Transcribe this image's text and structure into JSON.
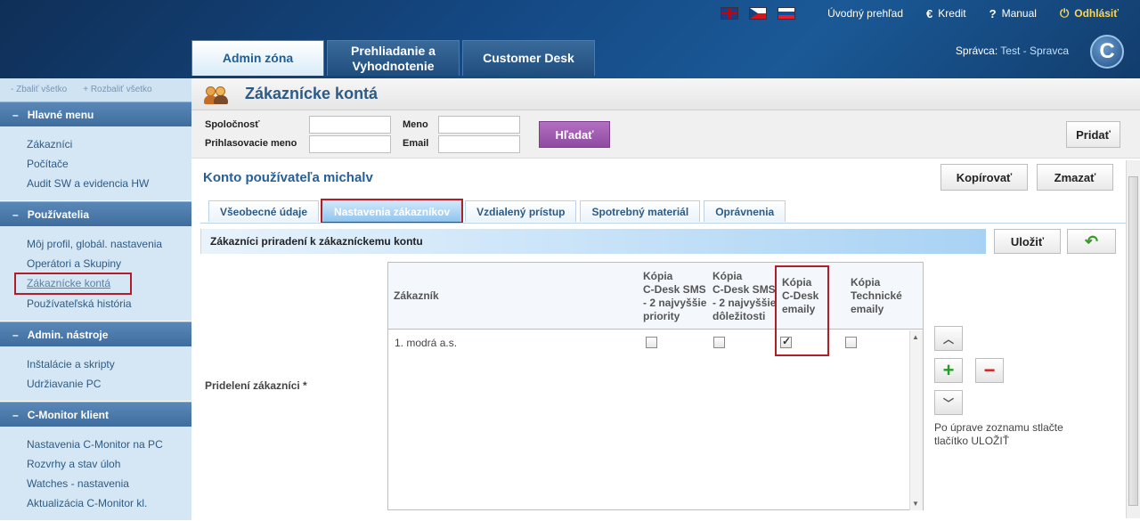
{
  "top": {
    "links": [
      {
        "icon": "home-icon",
        "label": "Úvodný prehľad"
      },
      {
        "icon": "euro-icon",
        "label": "Kredit",
        "glyph": "€"
      },
      {
        "icon": "help-icon",
        "label": "Manual",
        "glyph": "?"
      },
      {
        "icon": "power-icon",
        "label": "Odhlásiť",
        "glyph": "⏻"
      }
    ],
    "admin_label": "Správca:",
    "admin_name": "Test - Spravca",
    "logo_letter": "C"
  },
  "main_tabs": [
    {
      "label": "Admin zóna",
      "active": true
    },
    {
      "label": "Prehliadanie a Vyhodnotenie",
      "active": false
    },
    {
      "label": "Customer Desk",
      "active": false
    }
  ],
  "sidebar": {
    "collapse_all": "- Zbaliť všetko",
    "expand_all": "+ Rozbaliť všetko",
    "sections": [
      {
        "title": "Hlavné menu",
        "items": [
          "Zákazníci",
          "Počítače",
          "Audit SW a evidencia HW"
        ]
      },
      {
        "title": "Používatelia",
        "items": [
          "Môj profil, glob‌ál. nastavenia",
          "Operátori a Skupiny",
          "Zákaznícke kontá",
          "Používateľská história"
        ]
      },
      {
        "title": "Admin. nástroje",
        "items": [
          "Inštalácie a skripty",
          "Udržiavanie PC"
        ]
      },
      {
        "title": "C-Monitor klient",
        "items": [
          "Nastavenia C-Monitor na PC",
          "Rozvrhy a stav úloh",
          "Watches - nastavenia",
          "Aktualizácia C-Monitor kl."
        ]
      }
    ]
  },
  "page": {
    "title": "Zákaznícke kontá",
    "search": {
      "company_label": "Spoločnosť",
      "login_label": "Prihlasovacie meno",
      "name_label": "Meno",
      "email_label": "Email",
      "search_button": "Hľadať",
      "add_button": "Pridať"
    },
    "account_title": "Konto používateľa michalv",
    "copy_button": "Kopírovať",
    "delete_button": "Zmazať",
    "tabs": [
      "Všeobecné údaje",
      "Nastavenia zákazníkov",
      "Vzdialený prístup",
      "Spotrebný materiál",
      "Oprávnenia"
    ],
    "active_tab": 1,
    "bar_title": "Zákazníci priradení k zákazníckemu kontu",
    "save_button": "Uložiť",
    "assigned_label": "Pridelení zákazníci *",
    "grid": {
      "headers": {
        "customer": "Zákazník",
        "sms_priority": [
          "Kópia",
          "C-Desk SMS",
          "- 2 najvyššie",
          "priority"
        ],
        "sms_importance": [
          "Kópia",
          "C-Desk SMS",
          "- 2 najvyššie",
          "dôležitosti"
        ],
        "cdesk_emails": [
          "Kópia",
          "C-Desk",
          "emaily"
        ],
        "tech_emails": [
          "Kópia",
          "Technické",
          "emaily"
        ]
      },
      "rows": [
        {
          "customer": "1. modrá a.s.",
          "sms_priority": false,
          "sms_importance": false,
          "cdesk_emails": true,
          "tech_emails": false
        }
      ]
    },
    "note": "Po úprave zoznamu stlačte tlačítko ULOŽIŤ"
  }
}
